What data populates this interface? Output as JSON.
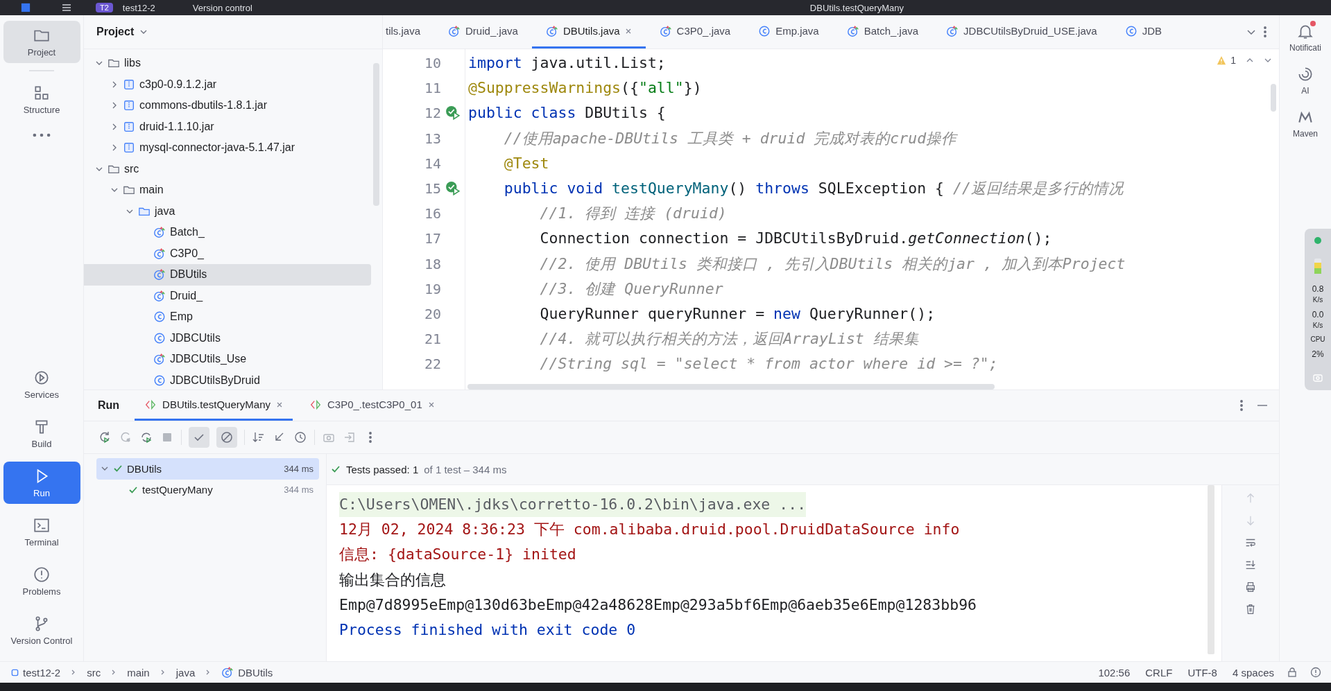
{
  "title_bar": {
    "project_badge": "T2",
    "project": "test12-2",
    "vcs": "Version control",
    "run_config": "DBUtils.testQueryMany"
  },
  "left_stripe": [
    {
      "label": "Project",
      "kind": "folder",
      "selected": true
    },
    {
      "label": "Structure",
      "kind": "structure",
      "selected": false
    },
    {
      "kind": "more",
      "selected": false
    },
    {
      "label": "Services",
      "kind": "services",
      "selected": false
    },
    {
      "label": "Build",
      "kind": "build",
      "selected": false
    },
    {
      "label": "Run",
      "kind": "run",
      "selected": true
    },
    {
      "label": "Terminal",
      "kind": "terminal",
      "selected": false
    },
    {
      "label": "Problems",
      "kind": "problems",
      "selected": false
    },
    {
      "label": "Version Control",
      "kind": "vcs",
      "selected": false
    }
  ],
  "right_stripe": [
    {
      "label": "Notificati",
      "kind": "bell",
      "alert": true
    },
    {
      "label": "AI",
      "kind": "ai",
      "alert": false
    },
    {
      "label": "Maven",
      "kind": "maven",
      "alert": false
    }
  ],
  "project": {
    "title": "Project",
    "tree": [
      {
        "label": "libs",
        "kind": "folder",
        "expanded": true,
        "selected": false,
        "children": [
          {
            "label": "c3p0-0.9.1.2.jar",
            "kind": "jar",
            "expanded": false,
            "selected": false
          },
          {
            "label": "commons-dbutils-1.8.1.jar",
            "kind": "jar",
            "expanded": false,
            "selected": false
          },
          {
            "label": "druid-1.1.10.jar",
            "kind": "jar",
            "expanded": false,
            "selected": false
          },
          {
            "label": "mysql-connector-java-5.1.47.jar",
            "kind": "jar",
            "expanded": false,
            "selected": false
          }
        ]
      },
      {
        "label": "src",
        "kind": "folder",
        "expanded": true,
        "selected": false,
        "children": [
          {
            "label": "main",
            "kind": "folder",
            "expanded": true,
            "selected": false,
            "children": [
              {
                "label": "java",
                "kind": "source",
                "expanded": true,
                "selected": false,
                "children": [
                  {
                    "label": "Batch_",
                    "kind": "test_class",
                    "selected": false
                  },
                  {
                    "label": "C3P0_",
                    "kind": "test_class",
                    "selected": false
                  },
                  {
                    "label": "DBUtils",
                    "kind": "test_class",
                    "selected": true
                  },
                  {
                    "label": "Druid_",
                    "kind": "test_class",
                    "selected": false
                  },
                  {
                    "label": "Emp",
                    "kind": "class",
                    "selected": false
                  },
                  {
                    "label": "JDBCUtils",
                    "kind": "class",
                    "selected": false
                  },
                  {
                    "label": "JDBCUtils_Use",
                    "kind": "test_class",
                    "selected": false
                  },
                  {
                    "label": "JDBCUtilsByDruid",
                    "kind": "class",
                    "selected": false
                  }
                ]
              }
            ]
          }
        ]
      }
    ]
  },
  "editor_tabs": [
    {
      "label": "tils.java",
      "kind": "plain",
      "selected": false
    },
    {
      "label": "Druid_.java",
      "kind": "test_class",
      "selected": false
    },
    {
      "label": "DBUtils.java",
      "kind": "test_class",
      "selected": true
    },
    {
      "label": "C3P0_.java",
      "kind": "test_class",
      "selected": false
    },
    {
      "label": "Emp.java",
      "kind": "class",
      "selected": false
    },
    {
      "label": "Batch_.java",
      "kind": "test_class",
      "selected": false
    },
    {
      "label": "JDBCUtilsByDruid_USE.java",
      "kind": "test_class",
      "selected": false
    },
    {
      "label": "JDB",
      "kind": "class",
      "selected": false
    }
  ],
  "editor": {
    "warnings": "1",
    "lines": [
      {
        "number": "10",
        "runnable": false,
        "tokens": [
          {
            "text": "import",
            "kind": "keyword"
          },
          {
            "text": " java.util.List;",
            "kind": "plain"
          }
        ]
      },
      {
        "number": "11",
        "runnable": false,
        "tokens": [
          {
            "text": "@SuppressWarnings",
            "kind": "annotation"
          },
          {
            "text": "({",
            "kind": "plain"
          },
          {
            "text": "\"all\"",
            "kind": "string"
          },
          {
            "text": "})",
            "kind": "plain"
          }
        ]
      },
      {
        "number": "12",
        "runnable": true,
        "tokens": [
          {
            "text": "public class",
            "kind": "keyword"
          },
          {
            "text": " DBUtils {",
            "kind": "plain"
          }
        ]
      },
      {
        "number": "13",
        "runnable": false,
        "tokens": [
          {
            "text": "    //使用apache-DBUtils 工具类 + druid 完成对表的crud操作",
            "kind": "comment"
          }
        ]
      },
      {
        "number": "14",
        "runnable": false,
        "tokens": [
          {
            "text": "    @Test",
            "kind": "annotation"
          }
        ]
      },
      {
        "number": "15",
        "runnable": true,
        "tokens": [
          {
            "text": "    public void ",
            "kind": "keyword"
          },
          {
            "text": "testQueryMany",
            "kind": "method"
          },
          {
            "text": "() ",
            "kind": "plain"
          },
          {
            "text": "throws",
            "kind": "keyword"
          },
          {
            "text": " SQLException { ",
            "kind": "plain"
          },
          {
            "text": "//返回结果是多行的情况",
            "kind": "comment"
          }
        ]
      },
      {
        "number": "16",
        "runnable": false,
        "tokens": [
          {
            "text": "        //1. 得到 连接 (druid)",
            "kind": "comment"
          }
        ]
      },
      {
        "number": "17",
        "runnable": false,
        "tokens": [
          {
            "text": "        Connection connection = JDBCUtilsByDruid.",
            "kind": "plain"
          },
          {
            "text": "getConnection",
            "kind": "static"
          },
          {
            "text": "();",
            "kind": "plain"
          }
        ]
      },
      {
        "number": "18",
        "runnable": false,
        "tokens": [
          {
            "text": "        //2. 使用 DBUtils 类和接口 , 先引入DBUtils 相关的jar , 加入到本Project",
            "kind": "comment"
          }
        ]
      },
      {
        "number": "19",
        "runnable": false,
        "tokens": [
          {
            "text": "        //3. 创建 QueryRunner",
            "kind": "comment"
          }
        ]
      },
      {
        "number": "20",
        "runnable": false,
        "tokens": [
          {
            "text": "        QueryRunner queryRunner = ",
            "kind": "plain"
          },
          {
            "text": "new",
            "kind": "keyword"
          },
          {
            "text": " QueryRunner();",
            "kind": "plain"
          }
        ]
      },
      {
        "number": "21",
        "runnable": false,
        "tokens": [
          {
            "text": "        //4. 就可以执行相关的方法，返回ArrayList 结果集",
            "kind": "comment"
          }
        ]
      },
      {
        "number": "22",
        "runnable": false,
        "tokens": [
          {
            "text": "        //String sql = \"select * from actor where id >= ?\";",
            "kind": "comment"
          }
        ]
      }
    ]
  },
  "run": {
    "title": "Run",
    "tabs": [
      {
        "label": "DBUtils.testQueryMany",
        "selected": true
      },
      {
        "label": "C3P0_.testC3P0_01",
        "selected": false
      }
    ],
    "filters": [
      {
        "kind": "passed",
        "on": true
      },
      {
        "kind": "ignored",
        "on": true
      }
    ],
    "tests": [
      {
        "label": "DBUtils",
        "time": "344 ms",
        "passed": true,
        "selected": true,
        "expanded": true,
        "children": [
          {
            "label": "testQueryMany",
            "time": "344 ms",
            "passed": true,
            "selected": false
          }
        ]
      }
    ],
    "summary": "Tests passed: 1",
    "summary_detail": "of 1 test – 344 ms",
    "console": [
      {
        "text": "C:\\Users\\OMEN\\.jdks\\corretto-16.0.2\\bin\\java.exe ...",
        "kind": "command"
      },
      {
        "text": "12月 02, 2024 8:36:23 下午 com.alibaba.druid.pool.DruidDataSource info",
        "kind": "log"
      },
      {
        "text": "信息: {dataSource-1} inited",
        "kind": "log"
      },
      {
        "text": "输出集合的信息",
        "kind": "output"
      },
      {
        "text": "Emp@7d8995eEmp@130d63beEmp@42a48628Emp@293a5bf6Emp@6aeb35e6Emp@1283bb96",
        "kind": "output"
      },
      {
        "text": "Process finished with exit code 0",
        "kind": "exit"
      }
    ]
  },
  "monitor": {
    "upload": "0.8",
    "upload_unit": "K/s",
    "download": "0.0",
    "download_unit": "K/s",
    "cpu_label": "CPU",
    "cpu": "2%"
  },
  "breadcrumbs": [
    {
      "label": "test12-2",
      "kind": "module"
    },
    {
      "label": "src",
      "kind": "folder"
    },
    {
      "label": "main",
      "kind": "folder"
    },
    {
      "label": "java",
      "kind": "folder"
    },
    {
      "label": "DBUtils",
      "kind": "test_class"
    }
  ],
  "status": {
    "position": "102:56",
    "line_ending": "CRLF",
    "encoding": "UTF-8",
    "indent": "4 spaces"
  }
}
